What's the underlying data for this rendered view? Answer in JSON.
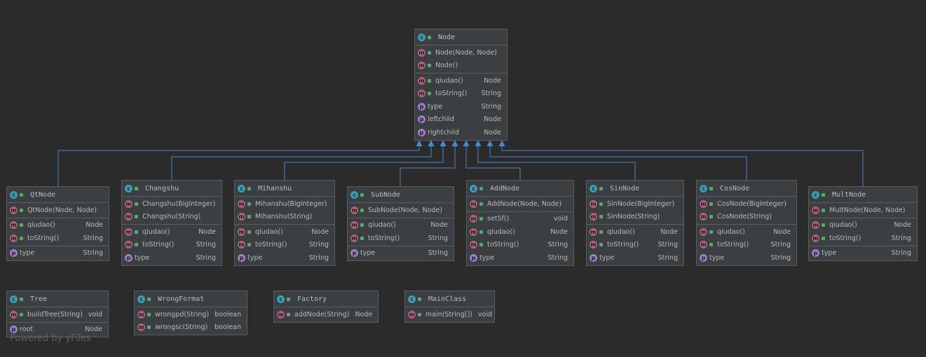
{
  "watermark": "Powered by yFiles",
  "classes": [
    {
      "id": "node",
      "name": "Node",
      "sections": [
        [
          {
            "k": "m",
            "n": "Node(Node, Node)",
            "t": ""
          },
          {
            "k": "m",
            "n": "Node()",
            "t": ""
          }
        ],
        [
          {
            "k": "m",
            "n": "qiudao()",
            "t": "Node"
          },
          {
            "k": "m",
            "n": "toString()",
            "t": "String"
          },
          {
            "k": "p",
            "n": "type",
            "t": "String"
          },
          {
            "k": "p",
            "n": "leftchild",
            "t": "Node"
          },
          {
            "k": "p",
            "n": "rightchild",
            "t": "Node"
          }
        ]
      ]
    },
    {
      "id": "qtnode",
      "name": "QtNode",
      "sections": [
        [
          {
            "k": "m",
            "n": "QtNode(Node, Node)",
            "t": ""
          }
        ],
        [
          {
            "k": "m",
            "n": "qiudao()",
            "t": "Node"
          },
          {
            "k": "m",
            "n": "toString()",
            "t": "String"
          }
        ],
        [
          {
            "k": "p",
            "n": "type",
            "t": "String"
          }
        ]
      ]
    },
    {
      "id": "changshu",
      "name": "Changshu",
      "sections": [
        [
          {
            "k": "m",
            "n": "Changshu(BigInteger)",
            "t": ""
          },
          {
            "k": "m",
            "n": "Changshu(String)",
            "t": ""
          }
        ],
        [
          {
            "k": "m",
            "n": "qiudao()",
            "t": "Node"
          },
          {
            "k": "m",
            "n": "toString()",
            "t": "String"
          },
          {
            "k": "p",
            "n": "type",
            "t": "String"
          }
        ]
      ]
    },
    {
      "id": "mihanshu",
      "name": "Mihanshu",
      "sections": [
        [
          {
            "k": "m",
            "n": "Mihanshu(BigInteger)",
            "t": ""
          },
          {
            "k": "m",
            "n": "Mihanshu(String)",
            "t": ""
          }
        ],
        [
          {
            "k": "m",
            "n": "qiudao()",
            "t": "Node"
          },
          {
            "k": "m",
            "n": "toString()",
            "t": "String"
          },
          {
            "k": "p",
            "n": "type",
            "t": "String"
          }
        ]
      ]
    },
    {
      "id": "subnode",
      "name": "SubNode",
      "sections": [
        [
          {
            "k": "m",
            "n": "SubNode(Node, Node)",
            "t": ""
          }
        ],
        [
          {
            "k": "m",
            "n": "qiudao()",
            "t": "Node"
          },
          {
            "k": "m",
            "n": "toString()",
            "t": "String"
          }
        ],
        [
          {
            "k": "p",
            "n": "type",
            "t": "String"
          }
        ]
      ]
    },
    {
      "id": "addnode",
      "name": "AddNode",
      "sections": [
        [
          {
            "k": "m",
            "n": "AddNode(Node, Node)",
            "t": ""
          }
        ],
        [
          {
            "k": "m",
            "n": "setSf()",
            "t": "void"
          },
          {
            "k": "m",
            "n": "qiudao()",
            "t": "Node"
          },
          {
            "k": "m",
            "n": "toString()",
            "t": "String"
          },
          {
            "k": "p",
            "n": "type",
            "t": "String"
          }
        ]
      ]
    },
    {
      "id": "sinnode",
      "name": "SinNode",
      "sections": [
        [
          {
            "k": "m",
            "n": "SinNode(BigInteger)",
            "t": ""
          },
          {
            "k": "m",
            "n": "SinNode(String)",
            "t": ""
          }
        ],
        [
          {
            "k": "m",
            "n": "qiudao()",
            "t": "Node"
          },
          {
            "k": "m",
            "n": "toString()",
            "t": "String"
          },
          {
            "k": "p",
            "n": "type",
            "t": "String"
          }
        ]
      ]
    },
    {
      "id": "cosnode",
      "name": "CosNode",
      "sections": [
        [
          {
            "k": "m",
            "n": "CosNode(BigInteger)",
            "t": ""
          },
          {
            "k": "m",
            "n": "CosNode(String)",
            "t": ""
          }
        ],
        [
          {
            "k": "m",
            "n": "qiudao()",
            "t": "Node"
          },
          {
            "k": "m",
            "n": "toString()",
            "t": "String"
          },
          {
            "k": "p",
            "n": "type",
            "t": "String"
          }
        ]
      ]
    },
    {
      "id": "multnode",
      "name": "MultNode",
      "sections": [
        [
          {
            "k": "m",
            "n": "MultNode(Node, Node)",
            "t": ""
          }
        ],
        [
          {
            "k": "m",
            "n": "qiudao()",
            "t": "Node"
          },
          {
            "k": "m",
            "n": "toString()",
            "t": "String"
          }
        ],
        [
          {
            "k": "p",
            "n": "type",
            "t": "String"
          }
        ]
      ]
    },
    {
      "id": "tree",
      "name": "Tree",
      "sections": [
        [
          {
            "k": "m",
            "n": "buildTree(String)",
            "t": "void"
          }
        ],
        [
          {
            "k": "p",
            "n": "root",
            "t": "Node"
          }
        ]
      ]
    },
    {
      "id": "wrongformat",
      "name": "WrongFormat",
      "sections": [
        [
          {
            "k": "m",
            "n": "wrongpd(String)",
            "t": "boolean"
          },
          {
            "k": "m",
            "n": "wrongsc(String)",
            "t": "boolean"
          }
        ]
      ]
    },
    {
      "id": "factory",
      "name": "Factory",
      "sections": [
        [
          {
            "k": "m",
            "n": "addNode(String)",
            "t": "Node"
          }
        ]
      ]
    },
    {
      "id": "mainclass",
      "name": "MainClass",
      "sections": [
        [
          {
            "k": "m",
            "n": "main(String[])",
            "t": "void"
          }
        ]
      ]
    }
  ],
  "icon_letters": {
    "class": "c",
    "method": "m",
    "property": "p"
  },
  "colors": {
    "edge": "#4a88c7",
    "class_icon": "#3c9cb4",
    "method_icon": "#b0627a",
    "property_icon": "#9e7ec7",
    "box": "#3c3f41"
  }
}
